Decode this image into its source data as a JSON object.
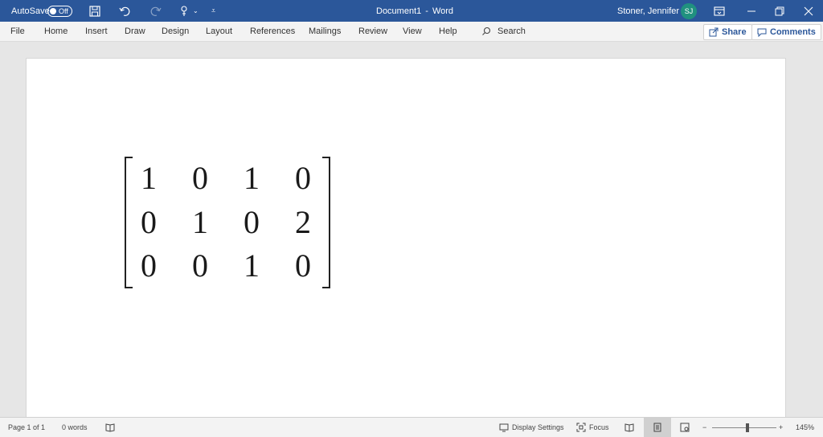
{
  "titlebar": {
    "autosave_label": "AutoSave",
    "autosave_state": "Off",
    "doc_title": "Document1",
    "separator": "-",
    "app_name": "Word",
    "user_name": "Stoner, Jennifer L",
    "user_initials": "SJ"
  },
  "menu": {
    "tabs": [
      "File",
      "Home",
      "Insert",
      "Draw",
      "Design",
      "Layout",
      "References",
      "Mailings",
      "Review",
      "View",
      "Help"
    ],
    "search_label": "Search",
    "share_label": "Share",
    "comments_label": "Comments"
  },
  "document": {
    "matrix": [
      [
        "1",
        "0",
        "1",
        "0"
      ],
      [
        "0",
        "1",
        "0",
        "2"
      ],
      [
        "0",
        "0",
        "1",
        "0"
      ]
    ]
  },
  "status": {
    "page": "Page 1 of 1",
    "words": "0 words",
    "display_settings": "Display Settings",
    "focus": "Focus",
    "zoom_minus": "−",
    "zoom_plus": "+",
    "zoom_level": "145%"
  },
  "colors": {
    "title_bar": "#2b579a",
    "avatar": "#20917f"
  }
}
